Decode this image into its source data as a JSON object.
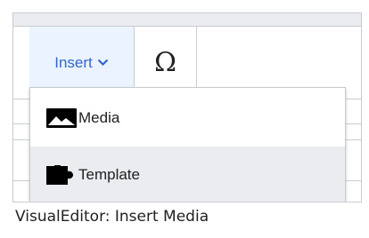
{
  "toolbar": {
    "insert_label": "Insert",
    "special_char_label": "Ω"
  },
  "menu": {
    "items": [
      {
        "label": "Media",
        "icon": "image-icon"
      },
      {
        "label": "Template",
        "icon": "puzzle-icon",
        "highlighted": true
      }
    ]
  },
  "caption": "VisualEditor: Insert Media",
  "colors": {
    "accent": "#3366cc",
    "insert_bg": "#eaf3ff",
    "highlight_bg": "#eaecf0",
    "border": "#c8ccd1",
    "text": "#202122"
  }
}
